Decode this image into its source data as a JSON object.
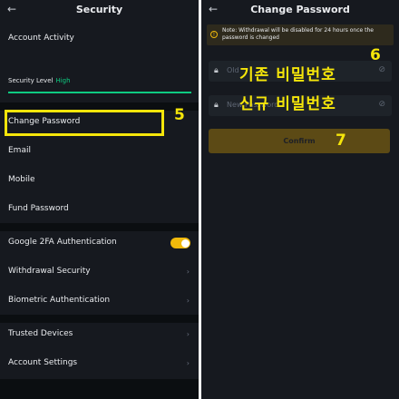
{
  "left": {
    "header": {
      "back_icon": "←",
      "title": "Security"
    },
    "account_activity": "Account Activity",
    "security_level": {
      "label": "Security Level",
      "value": "High",
      "color": "#0ecb81"
    },
    "items_group1": [
      {
        "label": "Change Password"
      },
      {
        "label": "Email"
      },
      {
        "label": "Mobile"
      },
      {
        "label": "Fund Password"
      }
    ],
    "items_group2": [
      {
        "label": "Google 2FA Authentication",
        "toggle_on": true
      },
      {
        "label": "Withdrawal Security",
        "chevron": "›"
      },
      {
        "label": "Biometric Authentication",
        "chevron": "›"
      }
    ],
    "items_group3": [
      {
        "label": "Trusted Devices",
        "chevron": "›"
      },
      {
        "label": "Account Settings",
        "chevron": "›"
      }
    ]
  },
  "right": {
    "header": {
      "back_icon": "←",
      "title": "Change Password"
    },
    "notice": {
      "icon": "!",
      "text": "Note: Withdrawal will be disabled for 24 hours once the password is changed"
    },
    "old_password": {
      "placeholder": "Old"
    },
    "new_password": {
      "placeholder": "New Password"
    },
    "confirm_label": "Confirm"
  },
  "annotations": {
    "n5": "5",
    "n6": "6",
    "n7": "7",
    "old_pw_korean": "기존 비밀번호",
    "new_pw_korean": "신규 비밀번호",
    "color": "#f5e50a"
  },
  "colors": {
    "accent": "#f0b90b",
    "bg": "#16191f",
    "separator": "#0b0e11"
  }
}
